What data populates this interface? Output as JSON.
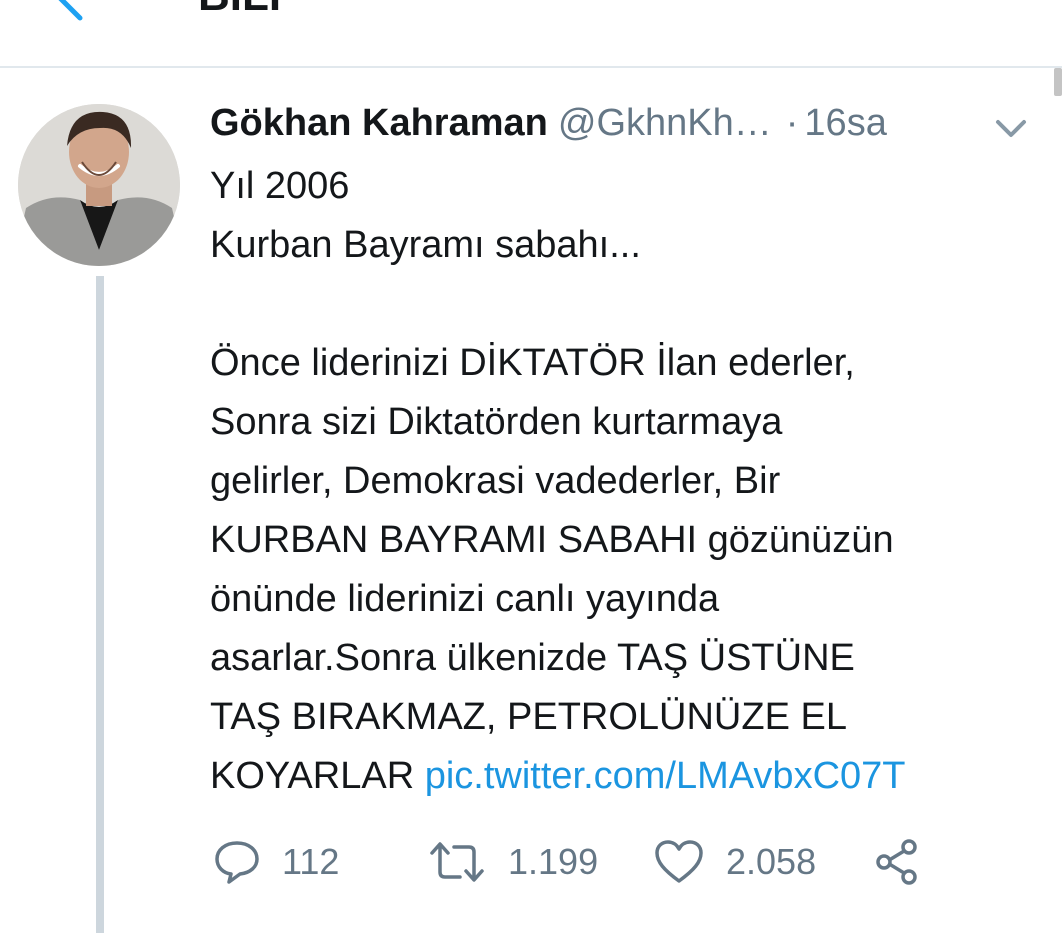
{
  "header": {
    "title": "BİLİ"
  },
  "tweet": {
    "author_name": "Gökhan Kahraman",
    "author_handle": "@GkhnKh…",
    "separator": "·",
    "timestamp": "16sa",
    "text_lines": [
      "Yıl 2006",
      "Kurban Bayramı sabahı...",
      "",
      "Önce liderinizi DİKTATÖR İlan ederler,",
      "Sonra sizi Diktatörden kurtarmaya",
      "gelirler, Demokrasi vadederler, Bir",
      "KURBAN BAYRAMI SABAHI gözünüzün",
      "önünde liderinizi canlı yayında",
      "asarlar.Sonra ülkenizde TAŞ ÜSTÜNE",
      "TAŞ BIRAKMAZ, PETROLÜNÜZE EL"
    ],
    "last_line_text": "KOYARLAR",
    "link_text": "pic.twitter.com/LMAvbxC07T"
  },
  "actions": {
    "reply_count": "112",
    "retweet_count": "1.199",
    "like_count": "2.058"
  },
  "icons": {
    "back": "back-arrow-icon",
    "caret": "chevron-down-icon",
    "reply": "reply-icon",
    "retweet": "retweet-icon",
    "like": "heart-icon",
    "share": "share-icon"
  },
  "colors": {
    "link": "#1b95e0",
    "secondary_text": "#657786",
    "primary_text": "#14171a",
    "thread_line": "#cdd6dd",
    "divider": "#e1e8ed"
  }
}
